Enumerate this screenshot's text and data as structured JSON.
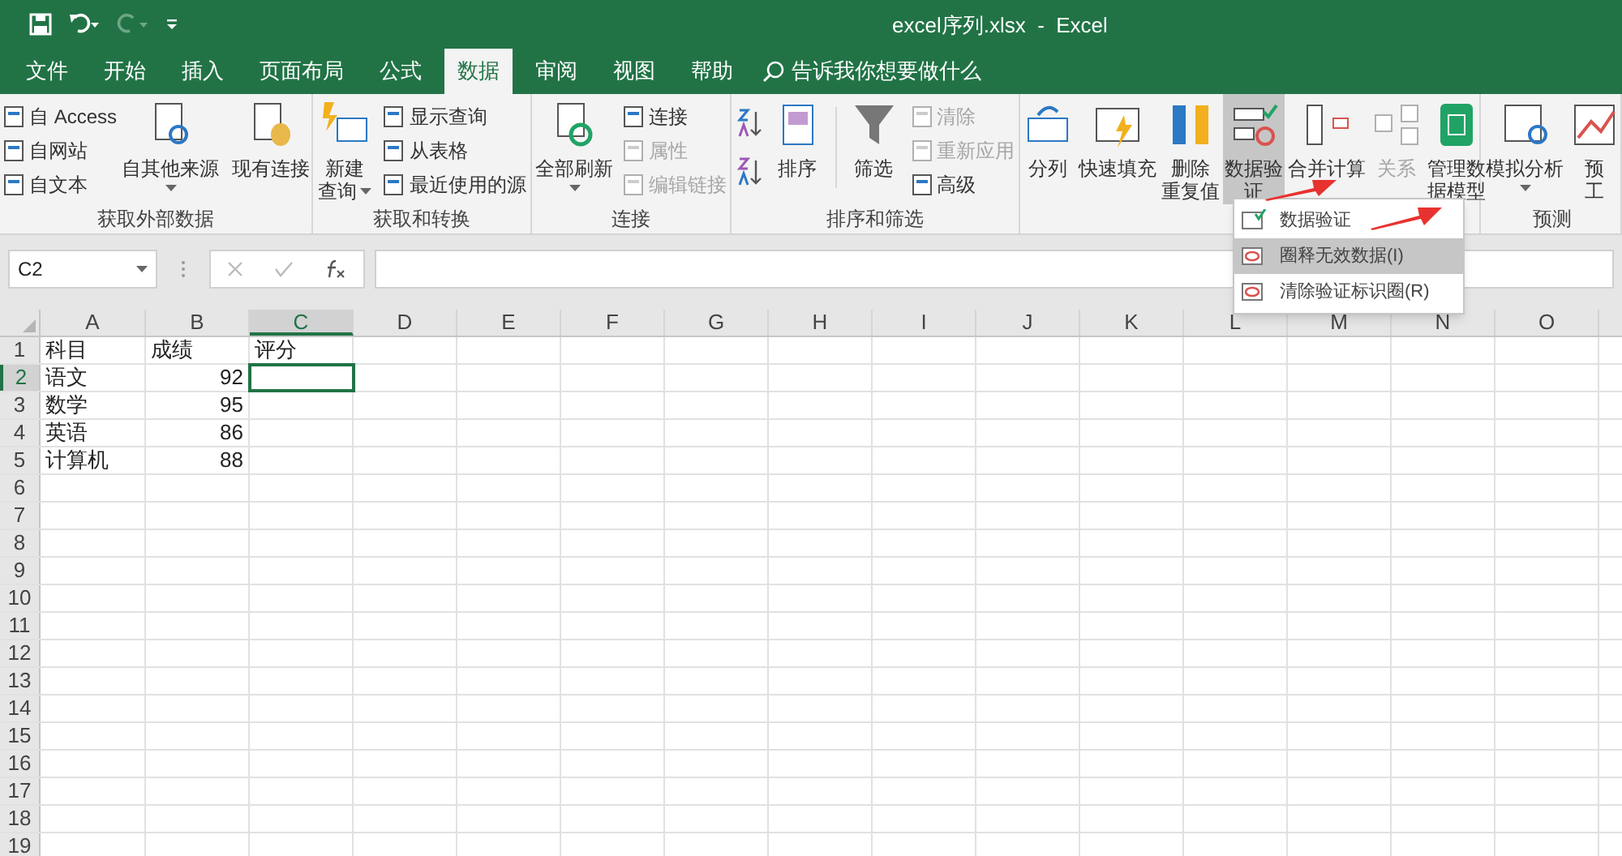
{
  "window": {
    "title": "excel序列.xlsx  -  Excel"
  },
  "tabs": [
    {
      "label": "文件",
      "selected": false
    },
    {
      "label": "开始",
      "selected": false
    },
    {
      "label": "插入",
      "selected": false
    },
    {
      "label": "页面布局",
      "selected": false
    },
    {
      "label": "公式",
      "selected": false
    },
    {
      "label": "数据",
      "selected": true
    },
    {
      "label": "审阅",
      "selected": false
    },
    {
      "label": "视图",
      "selected": false
    },
    {
      "label": "帮助",
      "selected": false
    }
  ],
  "search": {
    "placeholder": "告诉我你想要做什么"
  },
  "ribbon": {
    "groups": [
      {
        "label": "获取外部数据",
        "items": [
          {
            "kind": "stack",
            "entries": [
              {
                "label": "自 Access",
                "disabled": false
              },
              {
                "label": "自网站",
                "disabled": false
              },
              {
                "label": "自文本",
                "disabled": false
              }
            ]
          },
          {
            "kind": "large",
            "lines": [
              "自其他来源"
            ],
            "caret": true,
            "disabled": false,
            "selected": false
          },
          {
            "kind": "divider"
          },
          {
            "kind": "large",
            "lines": [
              "现有连接"
            ],
            "disabled": false,
            "selected": false
          }
        ]
      },
      {
        "label": "获取和转换",
        "items": [
          {
            "kind": "large",
            "lines": [
              "新建",
              "查询"
            ],
            "caret": true,
            "disabled": false,
            "selected": false
          },
          {
            "kind": "stack",
            "entries": [
              {
                "label": "显示查询",
                "disabled": false
              },
              {
                "label": "从表格",
                "disabled": false
              },
              {
                "label": "最近使用的源",
                "disabled": false
              }
            ]
          }
        ]
      },
      {
        "label": "连接",
        "items": [
          {
            "kind": "large",
            "lines": [
              "全部刷新"
            ],
            "caret": true,
            "disabled": false,
            "selected": false
          },
          {
            "kind": "stack",
            "entries": [
              {
                "label": "连接",
                "disabled": false
              },
              {
                "label": "属性",
                "disabled": true
              },
              {
                "label": "编辑链接",
                "disabled": true
              }
            ]
          }
        ]
      },
      {
        "label": "排序和筛选",
        "items": [
          {
            "kind": "sort_pair"
          },
          {
            "kind": "large",
            "lines": [
              "排序"
            ],
            "disabled": false,
            "selected": false
          },
          {
            "kind": "divider"
          },
          {
            "kind": "large",
            "lines": [
              "筛选"
            ],
            "disabled": false,
            "selected": false
          },
          {
            "kind": "stack",
            "entries": [
              {
                "label": "清除",
                "disabled": true
              },
              {
                "label": "重新应用",
                "disabled": true
              },
              {
                "label": "高级",
                "disabled": false
              }
            ]
          }
        ]
      },
      {
        "items": [
          {
            "kind": "large",
            "lines": [
              "分列"
            ],
            "disabled": false,
            "selected": false
          },
          {
            "kind": "large",
            "lines": [
              "快速填充"
            ],
            "disabled": false,
            "selected": false
          },
          {
            "kind": "large",
            "lines": [
              "删除",
              "重复值"
            ],
            "disabled": false,
            "selected": false
          },
          {
            "kind": "large",
            "lines": [
              "数据验",
              "证"
            ],
            "disabled": false,
            "selected": true
          },
          {
            "kind": "large",
            "lines": [
              "合并计算"
            ],
            "disabled": false,
            "selected": false
          },
          {
            "kind": "large",
            "lines": [
              "关系"
            ],
            "disabled": true,
            "selected": false
          },
          {
            "kind": "large",
            "lines": [
              "管理数",
              "据模型"
            ],
            "disabled": false,
            "selected": false
          }
        ]
      },
      {
        "label": "预测",
        "items": [
          {
            "kind": "large",
            "lines": [
              "模拟分析"
            ],
            "caret": true,
            "disabled": false,
            "selected": false
          },
          {
            "kind": "large",
            "lines": [
              "预",
              "工"
            ],
            "disabled": false,
            "selected": false
          }
        ]
      }
    ]
  },
  "menu": {
    "items": [
      {
        "label": "数据验证",
        "selected": false
      },
      {
        "label": "圈释无效数据(I)",
        "selected": true
      },
      {
        "label": "清除验证标识圈(R)",
        "selected": false
      }
    ]
  },
  "formula_bar": {
    "name_box": "C2"
  },
  "sheet": {
    "columns": [
      {
        "label": "A",
        "selected": false
      },
      {
        "label": "B",
        "selected": false
      },
      {
        "label": "C",
        "selected": true
      },
      {
        "label": "D",
        "selected": false
      },
      {
        "label": "E",
        "selected": false
      },
      {
        "label": "F",
        "selected": false
      },
      {
        "label": "G",
        "selected": false
      },
      {
        "label": "H",
        "selected": false
      },
      {
        "label": "I",
        "selected": false
      },
      {
        "label": "J",
        "selected": false
      },
      {
        "label": "K",
        "selected": false
      },
      {
        "label": "L",
        "selected": false
      },
      {
        "label": "M",
        "selected": false
      },
      {
        "label": "N",
        "selected": false
      },
      {
        "label": "O",
        "selected": false
      }
    ],
    "rows": [
      {
        "header": "1",
        "selected": false,
        "cells": [
          {
            "kind": "text",
            "text": "科目",
            "selected": false
          },
          {
            "kind": "text",
            "text": "成绩",
            "selected": false
          },
          {
            "kind": "text",
            "text": "评分",
            "selected": false
          }
        ]
      },
      {
        "header": "2",
        "selected": true,
        "cells": [
          {
            "kind": "text",
            "text": "语文",
            "selected": false
          },
          {
            "kind": "number",
            "text": "92",
            "selected": false
          },
          {
            "kind": "empty",
            "selected": true
          }
        ]
      },
      {
        "header": "3",
        "selected": false,
        "cells": [
          {
            "kind": "text",
            "text": "数学",
            "selected": false
          },
          {
            "kind": "number",
            "text": "95",
            "selected": false
          }
        ]
      },
      {
        "header": "4",
        "selected": false,
        "cells": [
          {
            "kind": "text",
            "text": "英语",
            "selected": false
          },
          {
            "kind": "number",
            "text": "86",
            "selected": false
          }
        ]
      },
      {
        "header": "5",
        "selected": false,
        "cells": [
          {
            "kind": "text",
            "text": "计算机",
            "selected": false
          },
          {
            "kind": "number",
            "text": "88",
            "selected": false
          }
        ]
      },
      {
        "header": "6",
        "selected": false
      },
      {
        "header": "7",
        "selected": false
      },
      {
        "header": "8",
        "selected": false
      },
      {
        "header": "9",
        "selected": false
      },
      {
        "header": "10",
        "selected": false
      },
      {
        "header": "11",
        "selected": false
      },
      {
        "header": "12",
        "selected": false
      },
      {
        "header": "13",
        "selected": false
      },
      {
        "header": "14",
        "selected": false
      },
      {
        "header": "15",
        "selected": false
      },
      {
        "header": "16",
        "selected": false
      },
      {
        "header": "17",
        "selected": false
      },
      {
        "header": "18",
        "selected": false
      },
      {
        "header": "19",
        "selected": false
      }
    ]
  }
}
